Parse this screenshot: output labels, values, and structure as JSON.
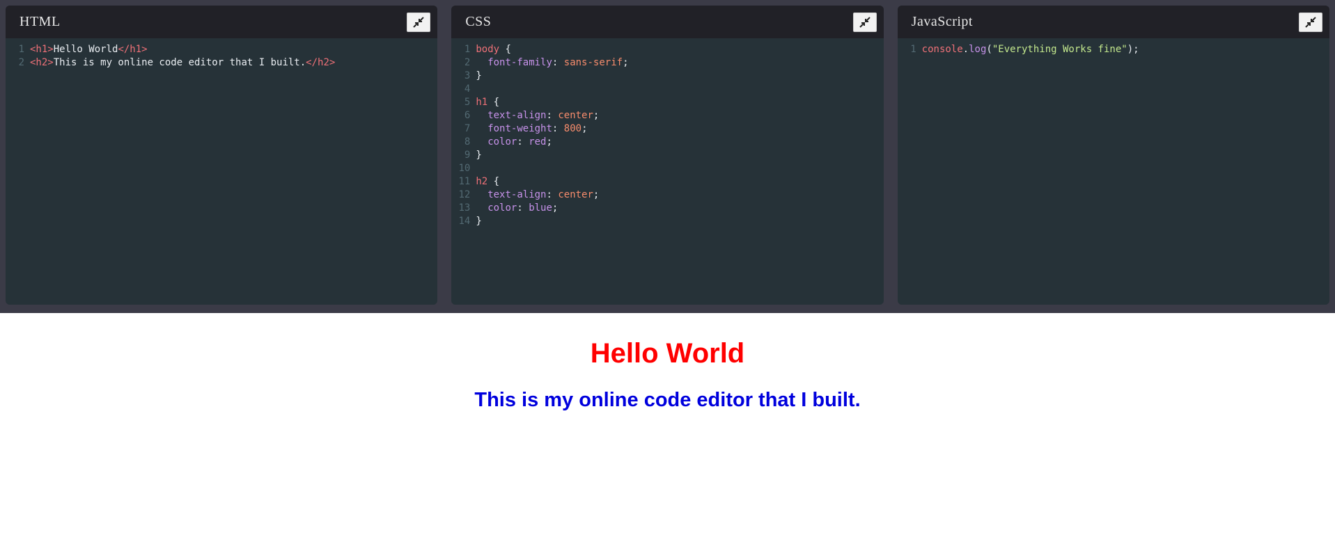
{
  "editors": [
    {
      "title": "HTML",
      "lines": [
        {
          "n": "1",
          "tokens": [
            [
              "tag",
              "<h1>"
            ],
            [
              "punct",
              "Hello World"
            ],
            [
              "tag",
              "</h1>"
            ]
          ]
        },
        {
          "n": "2",
          "tokens": [
            [
              "tag",
              "<h2>"
            ],
            [
              "punct",
              "This is my online code editor that I built."
            ],
            [
              "tag",
              "</h2>"
            ]
          ]
        }
      ]
    },
    {
      "title": "CSS",
      "lines": [
        {
          "n": "1",
          "tokens": [
            [
              "sel",
              "body"
            ],
            [
              "punct",
              " {"
            ]
          ]
        },
        {
          "n": "2",
          "tokens": [
            [
              "punct",
              "  "
            ],
            [
              "prop",
              "font-family"
            ],
            [
              "punct",
              ": "
            ],
            [
              "val",
              "sans-serif"
            ],
            [
              "punct",
              ";"
            ]
          ]
        },
        {
          "n": "3",
          "tokens": [
            [
              "punct",
              "}"
            ]
          ]
        },
        {
          "n": "4",
          "tokens": []
        },
        {
          "n": "5",
          "tokens": [
            [
              "sel",
              "h1"
            ],
            [
              "punct",
              " {"
            ]
          ]
        },
        {
          "n": "6",
          "tokens": [
            [
              "punct",
              "  "
            ],
            [
              "prop",
              "text-align"
            ],
            [
              "punct",
              ": "
            ],
            [
              "val",
              "center"
            ],
            [
              "punct",
              ";"
            ]
          ]
        },
        {
          "n": "7",
          "tokens": [
            [
              "punct",
              "  "
            ],
            [
              "prop",
              "font-weight"
            ],
            [
              "punct",
              ": "
            ],
            [
              "num",
              "800"
            ],
            [
              "punct",
              ";"
            ]
          ]
        },
        {
          "n": "8",
          "tokens": [
            [
              "punct",
              "  "
            ],
            [
              "prop",
              "color"
            ],
            [
              "punct",
              ": "
            ],
            [
              "prop",
              "red"
            ],
            [
              "punct",
              ";"
            ]
          ]
        },
        {
          "n": "9",
          "tokens": [
            [
              "punct",
              "}"
            ]
          ]
        },
        {
          "n": "10",
          "tokens": []
        },
        {
          "n": "11",
          "tokens": [
            [
              "sel",
              "h2"
            ],
            [
              "punct",
              " {"
            ]
          ]
        },
        {
          "n": "12",
          "tokens": [
            [
              "punct",
              "  "
            ],
            [
              "prop",
              "text-align"
            ],
            [
              "punct",
              ": "
            ],
            [
              "val",
              "center"
            ],
            [
              "punct",
              ";"
            ]
          ]
        },
        {
          "n": "13",
          "tokens": [
            [
              "punct",
              "  "
            ],
            [
              "prop",
              "color"
            ],
            [
              "punct",
              ": "
            ],
            [
              "prop",
              "blue"
            ],
            [
              "punct",
              ";"
            ]
          ]
        },
        {
          "n": "14",
          "tokens": [
            [
              "punct",
              "}"
            ]
          ]
        }
      ]
    },
    {
      "title": "JavaScript",
      "lines": [
        {
          "n": "1",
          "tokens": [
            [
              "obj",
              "console"
            ],
            [
              "punct",
              "."
            ],
            [
              "fn",
              "log"
            ],
            [
              "punct",
              "("
            ],
            [
              "str",
              "\"Everything Works fine\""
            ],
            [
              "punct",
              ");"
            ]
          ]
        }
      ]
    }
  ],
  "collapse_icon": "collapse-arrows-icon",
  "preview": {
    "h1": "Hello World",
    "h2": "This is my online code editor that I built."
  },
  "colors": {
    "editor_bg": "#263238",
    "titlebar_bg": "#212127",
    "outer_bg": "#3b3b47",
    "preview_h1": "#ff0000",
    "preview_h2": "#0000dd"
  }
}
